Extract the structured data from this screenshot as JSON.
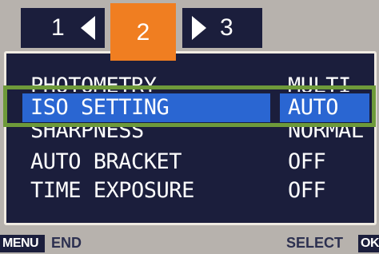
{
  "tabs": [
    {
      "label": "1"
    },
    {
      "label": "2"
    },
    {
      "label": "3"
    }
  ],
  "menu": {
    "rows": [
      {
        "name": "PHOTOMETRY",
        "value": "MULTI"
      },
      {
        "name": "ISO SETTING",
        "value": "AUTO"
      },
      {
        "name": "SHARPNESS",
        "value": "NORMAL"
      },
      {
        "name": "AUTO BRACKET",
        "value": "OFF"
      },
      {
        "name": "TIME EXPOSURE",
        "value": "OFF"
      }
    ]
  },
  "footer": {
    "menu_key": "MENU",
    "end_label": "END",
    "select_label": "SELECT",
    "ok_key": "OK"
  },
  "colors": {
    "panel": "#1b1e3c",
    "active_tab": "#f07e21",
    "selection": "#2a66d2",
    "highlight_frame": "#6e9a3a",
    "background": "#b7b2ad"
  }
}
